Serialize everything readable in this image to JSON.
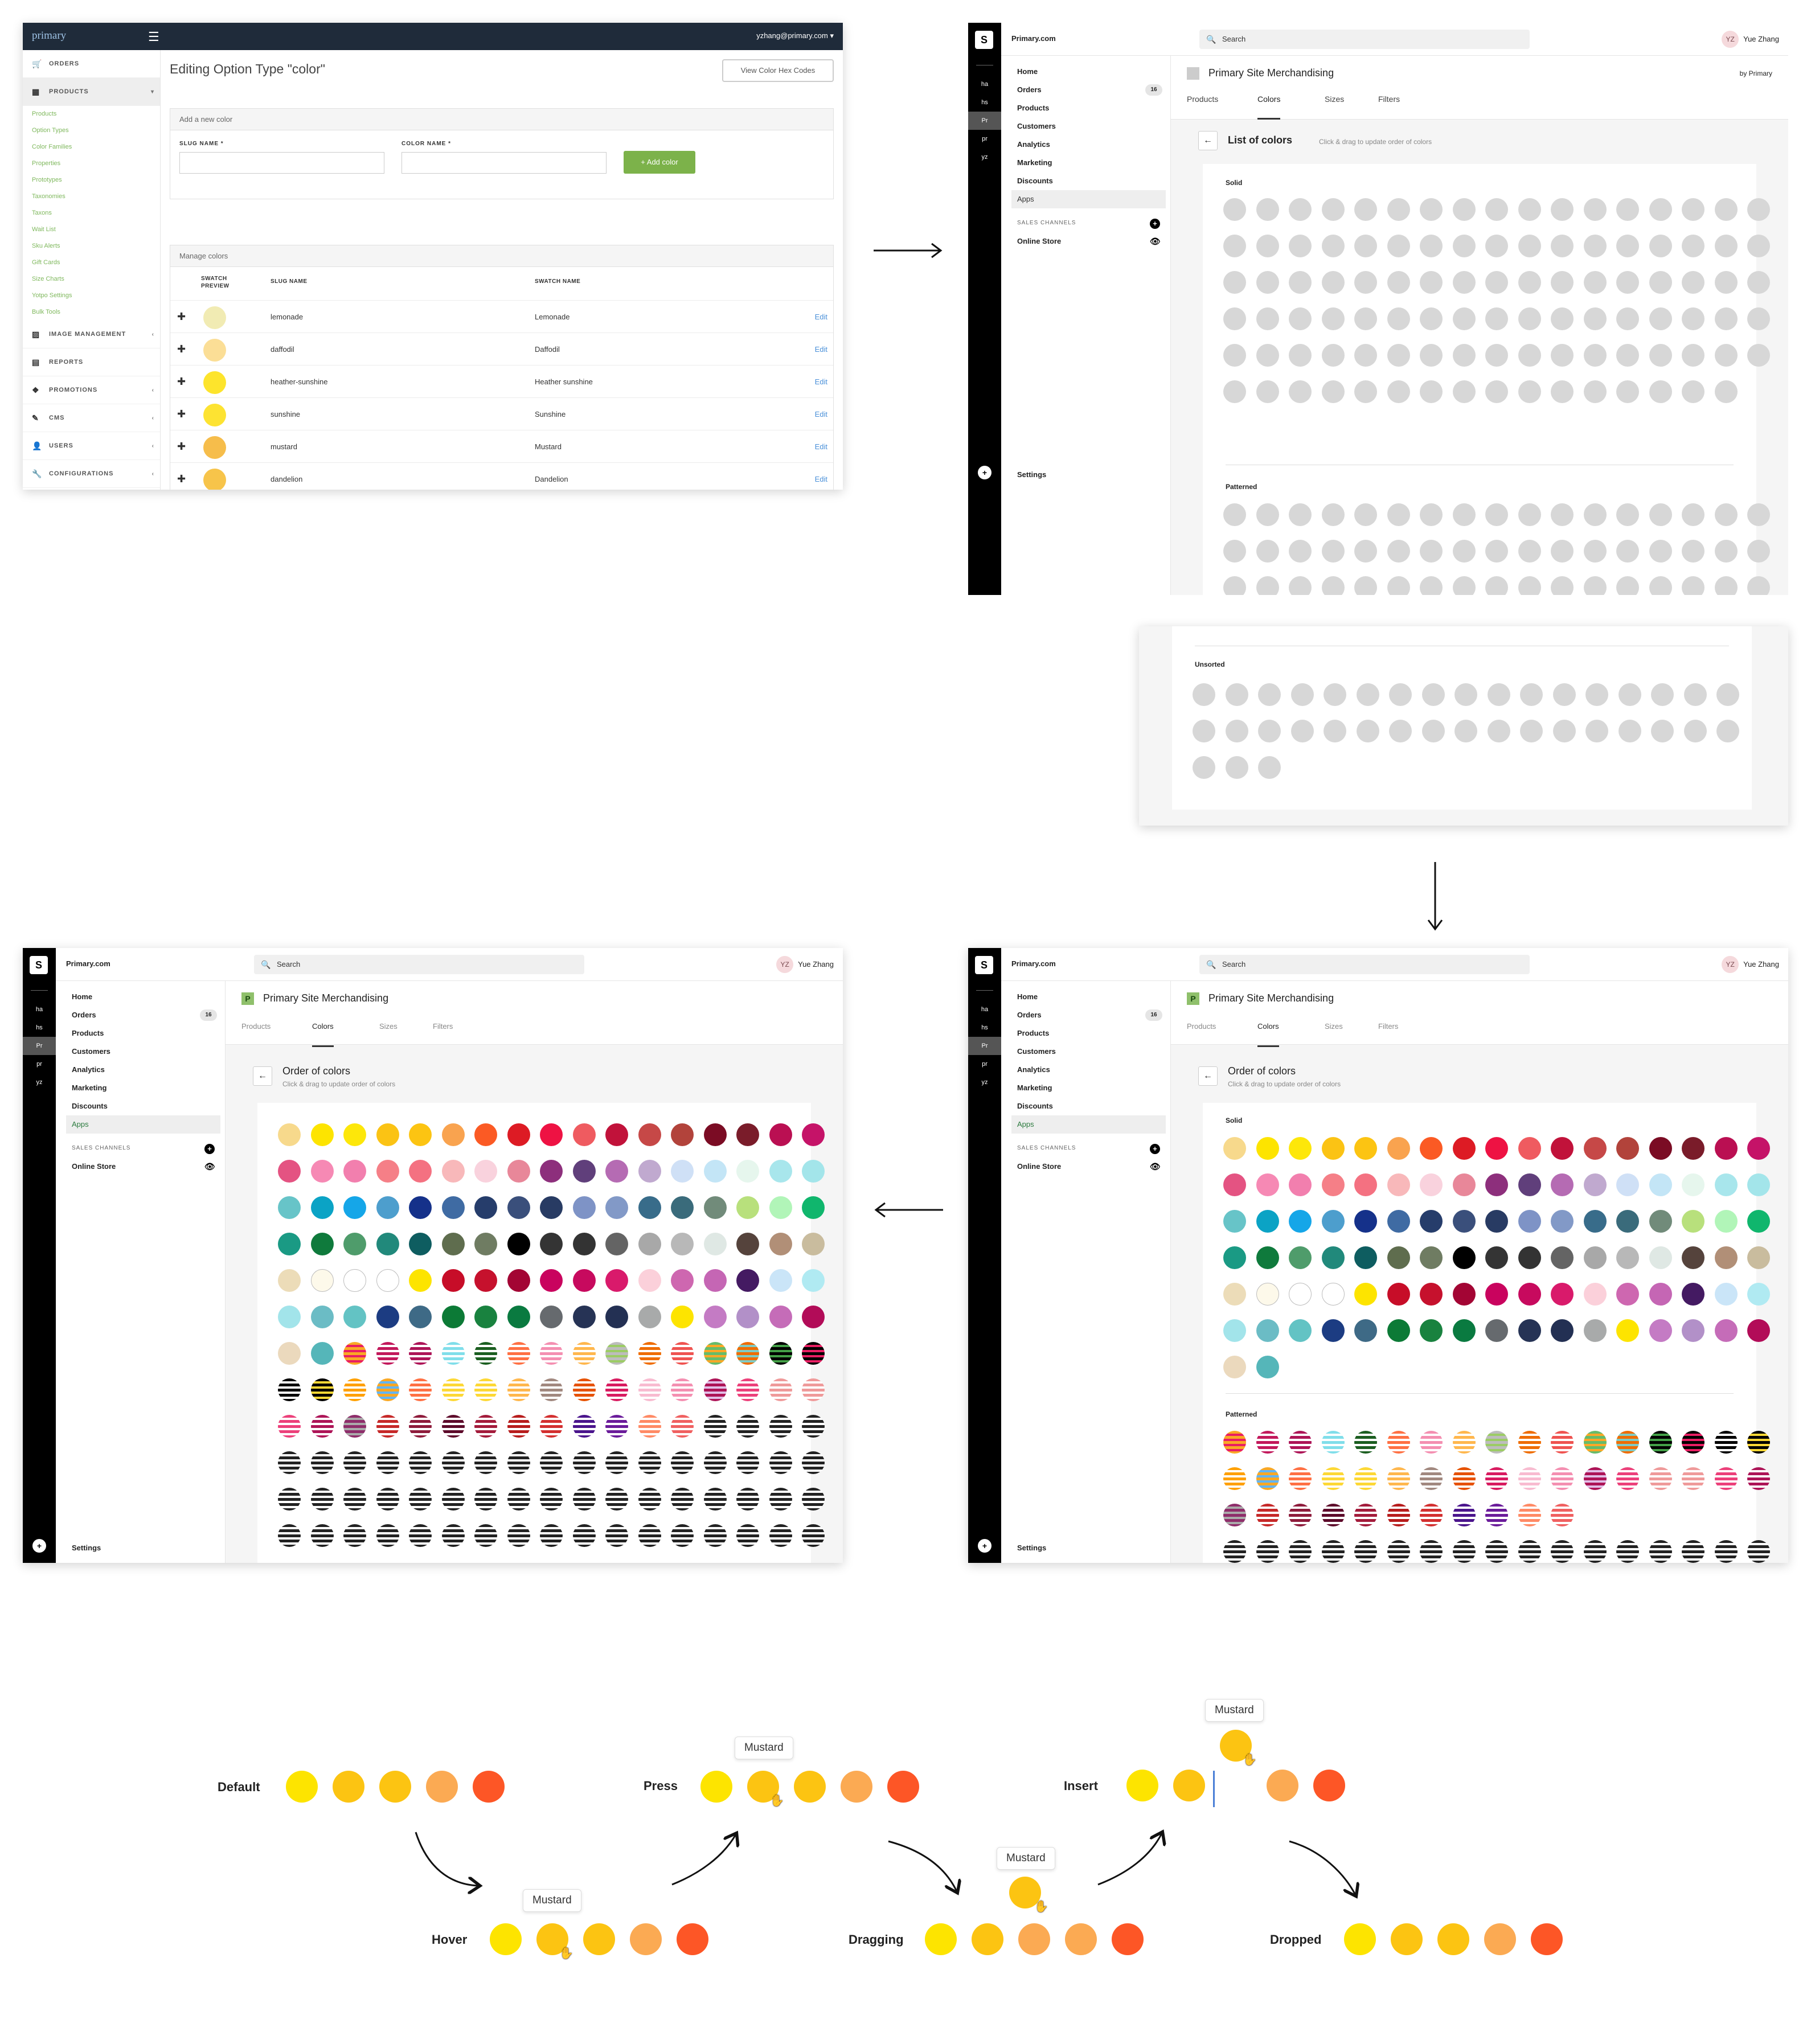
{
  "admin": {
    "logo": "primary",
    "user": "yzhang@primary.com ▾",
    "nav": [
      {
        "icon": "cart-icon",
        "glyph": "🛒",
        "label": "ORDERS",
        "caret": ""
      },
      {
        "icon": "grid-icon",
        "glyph": "▦",
        "label": "PRODUCTS",
        "caret": "▾"
      }
    ],
    "subnav": [
      "Products",
      "Option Types",
      "Color Families",
      "Properties",
      "Prototypes",
      "Taxonomies",
      "Taxons",
      "Wait List",
      "Sku Alerts",
      "Gift Cards",
      "Size Charts",
      "Yotpo Settings",
      "Bulk Tools"
    ],
    "nav2": [
      {
        "icon": "image-icon",
        "glyph": "▨",
        "label": "IMAGE MANAGEMENT",
        "caret": "‹"
      },
      {
        "icon": "chart-icon",
        "glyph": "▤",
        "label": "REPORTS",
        "caret": ""
      },
      {
        "icon": "promo-icon",
        "glyph": "❖",
        "label": "PROMOTIONS",
        "caret": "‹"
      },
      {
        "icon": "pencil-icon",
        "glyph": "✎",
        "label": "CMS",
        "caret": "‹"
      },
      {
        "icon": "user-icon",
        "glyph": "👤",
        "label": "USERS",
        "caret": "‹"
      },
      {
        "icon": "wrench-icon",
        "glyph": "🔧",
        "label": "CONFIGURATIONS",
        "caret": "‹"
      }
    ],
    "title": "Editing Option Type \"color\"",
    "view_hex_button": "View Color Hex Codes",
    "add_box_title": "Add a new color",
    "slug_label": "SLUG NAME *",
    "color_label": "COLOR NAME *",
    "add_button": "+ Add color",
    "manage_title": "Manage colors",
    "th_swatch": "SWATCH PREVIEW",
    "th_slug": "SLUG NAME",
    "th_name": "SWATCH NAME",
    "rows": [
      {
        "color": "#f1ebb3",
        "slug": "lemonade",
        "name": "Lemonade",
        "edit": "Edit"
      },
      {
        "color": "#fbde96",
        "slug": "daffodil",
        "name": "Daffodil",
        "edit": "Edit"
      },
      {
        "color": "#fde42c",
        "slug": "heather-sunshine",
        "name": "Heather sunshine",
        "edit": "Edit"
      },
      {
        "color": "#fde332",
        "slug": "sunshine",
        "name": "Sunshine",
        "edit": "Edit"
      },
      {
        "color": "#f6bd4b",
        "slug": "mustard",
        "name": "Mustard",
        "edit": "Edit"
      },
      {
        "color": "#f7c44a",
        "slug": "dandelion",
        "name": "Dandelion",
        "edit": "Edit"
      }
    ]
  },
  "shop": {
    "store": "Primary.com",
    "search": "Search",
    "avatar": "YZ",
    "user": "Yue Zhang",
    "left_items": [
      "ha",
      "hs",
      "Pr",
      "pr",
      "yz"
    ],
    "nav": [
      "Home",
      "Orders",
      "Products",
      "Customers",
      "Analytics",
      "Marketing",
      "Discounts",
      "Apps"
    ],
    "orders_badge": "16",
    "sales_channels": "SALES CHANNELS",
    "online_store": "Online Store",
    "settings": "Settings",
    "page_title": "Primary Site Merchandising",
    "by": "by Primary",
    "app_letter": "P",
    "tabs": [
      "Products",
      "Colors",
      "Sizes",
      "Filters"
    ],
    "list_title": "List of colors",
    "list_hint": "Click & drag to update order of colors",
    "order_title": "Order of colors",
    "order_hint": "Click & drag to update order of colors",
    "solid": "Solid",
    "patterned": "Patterned",
    "unsorted": "Unsorted"
  },
  "colors": {
    "solid": [
      "#f7d98c",
      "#fde400",
      "#fde70a",
      "#fbc314",
      "#fcc412",
      "#f9a34f",
      "#fb5a24",
      "#dd1b24",
      "#ee1243",
      "#ef5b60",
      "#c1123a",
      "#c64847",
      "#b2433b",
      "#7b0c24",
      "#7a1c2a",
      "#ba0f52",
      "#c51368",
      "#e45382",
      "#f689b4",
      "#f27fae",
      "#f57f87",
      "#f47181",
      "#f8b8ba",
      "#f9d2dd",
      "#e88799",
      "#8d2f7c",
      "#603f7b",
      "#b56bb3",
      "#c0a9cf",
      "#cfe0f6",
      "#c3e5f6",
      "#e6f6ed",
      "#a8e6ec",
      "#a3e5ea",
      "#67c4c8",
      "#0ba3c5",
      "#15a6e8",
      "#4d9ecd",
      "#15318a",
      "#3f6ba3",
      "#263d6b",
      "#3a4f7b",
      "#283b63",
      "#7e93c6",
      "#8299c7",
      "#386c8a",
      "#3a6b7b",
      "#718b7a",
      "#b8e07c",
      "#b1f5b8",
      "#10b66d",
      "#1a9a84",
      "#0f7a3c",
      "#4f9c6b",
      "#21897b",
      "#0e5d60",
      "#5f6d4e",
      "#6f7c62",
      "#000000",
      "#343434",
      "#333333",
      "#646464",
      "#a8a8a8",
      "#b8b8b8",
      "#dfe8e4",
      "#55433c",
      "#b18f77",
      "#c9bc9e",
      "#ecdcb8",
      "#fdf9ea",
      "#ffffff",
      "#ffffff",
      "#fde400",
      "#c70d28",
      "#c6112d",
      "#a30534",
      "#c9035e",
      "#c70a5e",
      "#d91a6b",
      "#fbd0da",
      "#ce67b0",
      "#c566b4",
      "#441a62",
      "#cae5f8",
      "#b0eaf2",
      "#a2e4ea",
      "#6bbcc5",
      "#63c3c4",
      "#1c3c82",
      "#3e6a86",
      "#0c7a36",
      "#19823f",
      "#0a7a40",
      "#666a6e",
      "#263355",
      "#233053",
      "#a8aaaa",
      "#fde400",
      "#c47bc4",
      "#b290c8",
      "#c56cb8",
      "#b20c58",
      "#ebd9bd",
      "#55b6b9"
    ],
    "patterned": [
      [
        "#f9a825",
        "#e91e63",
        "#4caf50"
      ],
      [
        "#c2185b",
        "#fff"
      ],
      [
        "#ad1457",
        "#fff"
      ],
      [
        "#80deea",
        "#fff"
      ],
      [
        "#1b5e20",
        "#fff"
      ],
      [
        "#ff7043",
        "#fff"
      ],
      [
        "#f48fb1",
        "#fff"
      ],
      [
        "#ffb74d",
        "#fff"
      ],
      [
        "#bdbdbd",
        "#9ccc65"
      ],
      [
        "#ef6c00",
        "#fff"
      ],
      [
        "#ef5350",
        "#fff"
      ],
      [
        "#66bb6a",
        "#ffa726"
      ],
      [
        "#ef6c00",
        "#80cbc4"
      ],
      [
        "#000",
        "#43a047"
      ],
      [
        "#000",
        "#e91e63"
      ],
      [
        "#000",
        "#fff"
      ],
      [
        "#000",
        "#fdd835"
      ],
      [
        "#ffa000",
        "#fff"
      ],
      [
        "#f9a825",
        "#64b5f6"
      ],
      [
        "#ff7043",
        "#fff"
      ],
      [
        "#fdd835",
        "#fff"
      ],
      [
        "#fdd835",
        "#fff"
      ],
      [
        "#ffb74d",
        "#fff"
      ],
      [
        "#a1887f",
        "#fff"
      ],
      [
        "#e65100",
        "#fff"
      ],
      [
        "#d81b60",
        "#fff"
      ],
      [
        "#f8bbd0",
        "#fff"
      ],
      [
        "#f48fb1",
        "#fff"
      ],
      [
        "#ad1457",
        "#e1bee7"
      ],
      [
        "#ec407a",
        "#fff"
      ],
      [
        "#ef9a9a",
        "#fff"
      ],
      [
        "#ef9a9a",
        "#fff"
      ],
      [
        "#ec407a",
        "#fff"
      ],
      [
        "#ad1457",
        "#fff"
      ],
      [
        "#8e2d6a",
        "#aaa"
      ],
      [
        "#c62828",
        "#fff"
      ],
      [
        "#8e1b3b",
        "#fff"
      ],
      [
        "#5d0a2a",
        "#fff"
      ],
      [
        "#a31b3b",
        "#fff"
      ],
      [
        "#b71c1c",
        "#fff"
      ],
      [
        "#d32f2f",
        "#fff"
      ],
      [
        "#4a148c",
        "#fff"
      ],
      [
        "#6a1b9a",
        "#fff"
      ],
      [
        "#ff8a65",
        "#fff"
      ],
      [
        "#f06060",
        "#fff"
      ]
    ]
  },
  "flow": {
    "default": "Default",
    "hover": "Hover",
    "press": "Press",
    "dragging": "Dragging",
    "insert": "Insert",
    "dropped": "Dropped",
    "tooltip": "Mustard",
    "dots": [
      "#fde400",
      "#fcc412",
      "#fcc412",
      "#fbaa53",
      "#fd5626"
    ]
  }
}
